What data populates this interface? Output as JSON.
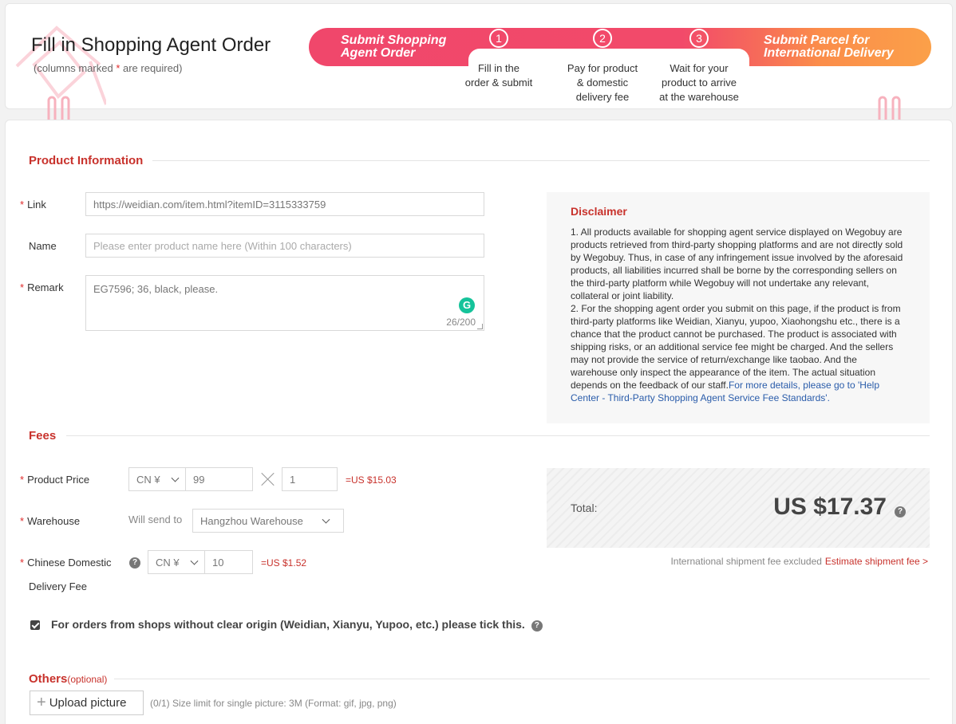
{
  "header": {
    "title": "Fill in Shopping Agent Order",
    "subtitle_before": "(columns marked ",
    "subtitle_star": "*",
    "subtitle_after": " are required)"
  },
  "steps": {
    "left_label_line1": "Submit Shopping",
    "left_label_line2": "Agent Order",
    "right_label_line1": "Submit Parcel for",
    "right_label_line2": "International Delivery",
    "items": [
      {
        "num": "1",
        "line1": "Fill in the",
        "line2": "order & submit",
        "line3": ""
      },
      {
        "num": "2",
        "line1": "Pay for product",
        "line2": "& domestic",
        "line3": "delivery fee"
      },
      {
        "num": "3",
        "line1": "Wait for your",
        "line2": "product to arrive",
        "line3": "at the warehouse"
      }
    ]
  },
  "product": {
    "section_title": "Product Information",
    "link_label": "Link",
    "link_value": "https://weidian.com/item.html?itemID=3115333759",
    "name_label": "Name",
    "name_placeholder": "Please enter product name here (Within 100 characters)",
    "remark_label": "Remark",
    "remark_value": "EG7596; 36, black, please.",
    "remark_counter": "26/200",
    "required_star": "*"
  },
  "disclaimer": {
    "title": "Disclaimer",
    "para1": "1. All products available for shopping agent service displayed on Wegobuy are products retrieved from third-party shopping platforms and are not directly sold by Wegobuy. Thus, in case of any infringement issue involved by the aforesaid products, all liabilities incurred shall be borne by the corresponding sellers on the third-party platform while Wegobuy will not undertake any relevant, collateral or joint liability.",
    "para2": "2. For the shopping agent order you submit on this page, if the product is from third-party platforms like Weidian, Xianyu, yupoo, Xiaohongshu etc., there is a chance that the product cannot be purchased. The product is associated with shipping risks, or an additional service fee might be charged. And the sellers may not provide the service of return/exchange like taobao. And the warehouse only inspect the appearance of the item. The actual situation depends on the feedback of our staff.",
    "link": "For more details, please go to 'Help Center - Third-Party Shopping Agent Service Fee Standards'."
  },
  "fees": {
    "section_title": "Fees",
    "price_label": "Product Price",
    "currency": "CN ¥",
    "price_value": "99",
    "quantity_value": "1",
    "price_converted": "=US $15.03",
    "warehouse_label": "Warehouse",
    "will_send_to": "Will send to",
    "warehouse_value": "Hangzhou Warehouse",
    "domestic_label_line1": "Chinese Domestic",
    "domestic_label_line2": "Delivery Fee",
    "domestic_value": "10",
    "domestic_converted": "=US $1.52",
    "total_label": "Total:",
    "total_amount": "US $17.37",
    "shipment_excluded": "International shipment fee excluded",
    "estimate_link": "Estimate shipment fee >",
    "checkbox_text": "For orders from shops without clear origin (Weidian, Xianyu, Yupoo, etc.) please tick this.",
    "help_glyph": "?"
  },
  "others": {
    "section_title": "Others",
    "optional": "(optional)",
    "upload_label": "Upload picture",
    "upload_note": "(0/1)  Size limit for single picture: 3M (Format: gif, jpg, png)"
  },
  "colors": {
    "accent_red": "#c8322c",
    "banner_pink": "#f0476b",
    "banner_orange": "#fba049"
  }
}
